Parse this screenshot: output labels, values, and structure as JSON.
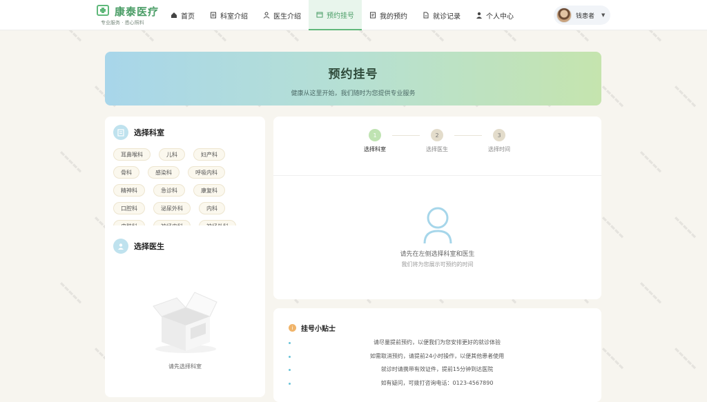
{
  "brand": {
    "title": "康泰医疗",
    "subtitle": "专业服务 · 悉心照料"
  },
  "nav": [
    {
      "label": "首页",
      "icon": "home-icon"
    },
    {
      "label": "科室介绍",
      "icon": "building-icon"
    },
    {
      "label": "医生介绍",
      "icon": "doctor-icon"
    },
    {
      "label": "预约挂号",
      "icon": "calendar-icon",
      "active": true
    },
    {
      "label": "我的预约",
      "icon": "document-icon"
    },
    {
      "label": "就诊记录",
      "icon": "record-icon"
    },
    {
      "label": "个人中心",
      "icon": "user-icon"
    }
  ],
  "user": {
    "name": "钱患者"
  },
  "hero": {
    "title": "预约挂号",
    "subtitle": "健康从这里开始，我们随时为您提供专业服务"
  },
  "departments": {
    "title": "选择科室",
    "items": [
      "耳鼻喉科",
      "儿科",
      "妇产科",
      "骨科",
      "感染科",
      "呼吸内科",
      "精神科",
      "急诊科",
      "康复科",
      "口腔科",
      "泌尿外科",
      "内科",
      "皮肤科",
      "神经内科",
      "神经外科"
    ]
  },
  "doctors": {
    "title": "选择医生",
    "empty_hint": "请先选择科室"
  },
  "steps": [
    {
      "num": "1",
      "label": "选择科室",
      "active": true
    },
    {
      "num": "2",
      "label": "选择医生",
      "active": false
    },
    {
      "num": "3",
      "label": "选择时间",
      "active": false
    }
  ],
  "time_panel": {
    "empty_main": "请先在左侧选择科室和医生",
    "empty_sub": "我们将为您展示可预约的时间"
  },
  "tips": {
    "title": "挂号小贴士",
    "icon_text": "i",
    "items": [
      "请尽量提前预约，以便我们为您安排更好的就诊体验",
      "如需取消预约，请提前24小时操作，以便其他患者使用",
      "就诊时请携带有效证件，提前15分钟到达医院",
      "如有疑问，可拨打咨询电话：0123-4567890"
    ]
  },
  "colors": {
    "accent": "#5fb87a",
    "hero_start": "#a8d6ea",
    "hero_end": "#c5e4ae"
  }
}
